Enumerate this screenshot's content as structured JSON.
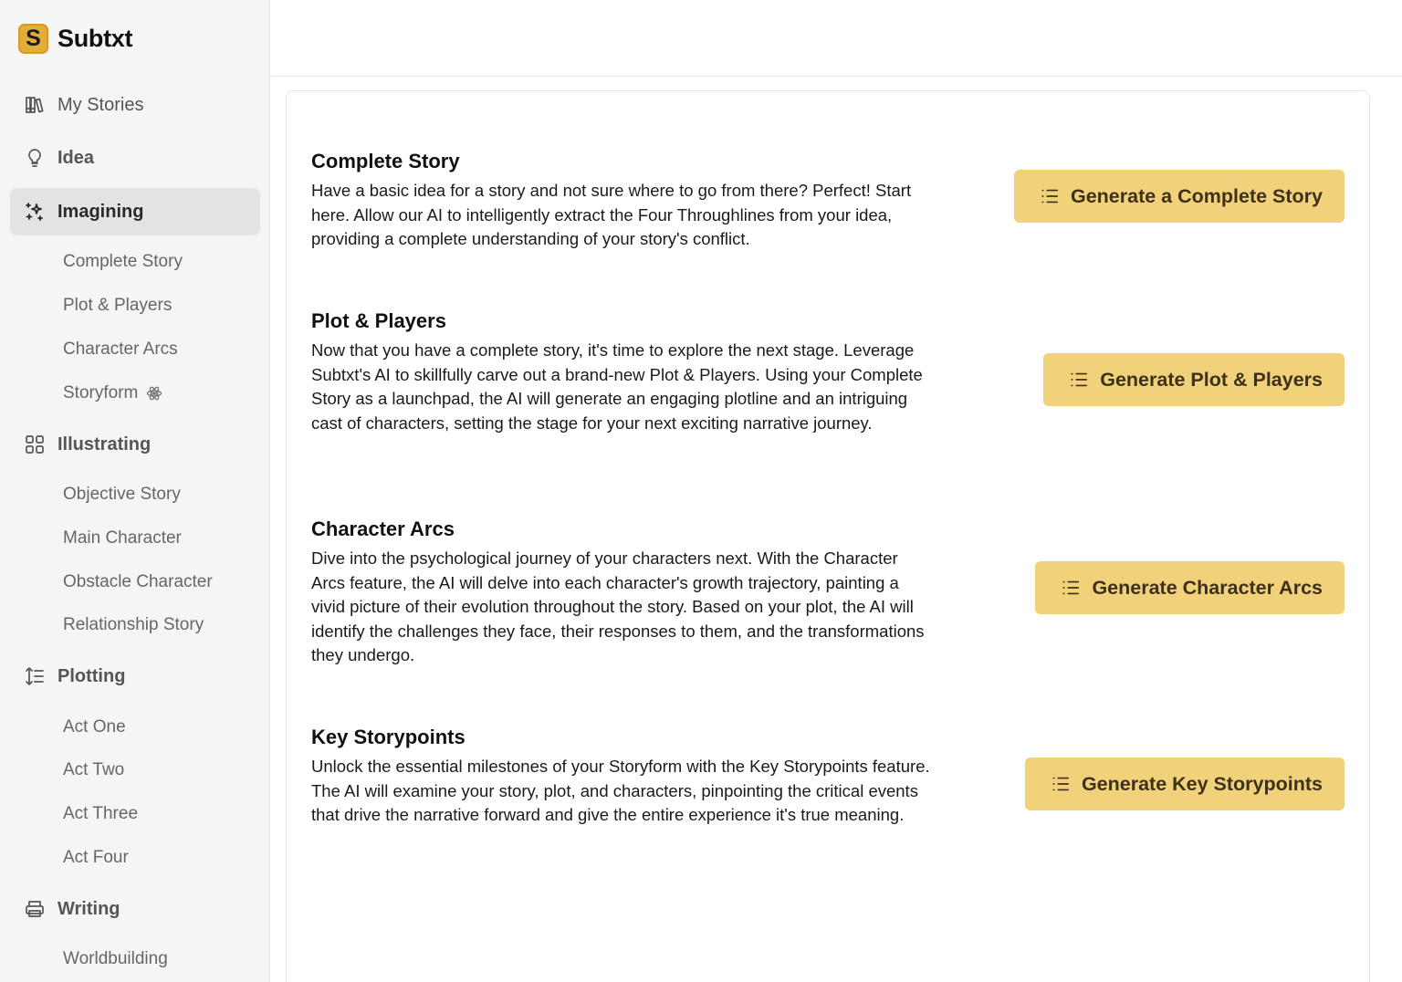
{
  "brand": {
    "logo_letter": "S",
    "name": "Subtxt",
    "accent": "#e3ad3c"
  },
  "sidebar": {
    "my_stories": {
      "label": "My Stories",
      "icon": "library-icon"
    },
    "idea": {
      "label": "Idea",
      "icon": "lightbulb-icon"
    },
    "imagining": {
      "label": "Imagining",
      "icon": "sparkles-icon",
      "items": [
        "Complete Story",
        "Plot & Players",
        "Character Arcs",
        "Storyform"
      ]
    },
    "illustrating": {
      "label": "Illustrating",
      "icon": "grid-icon",
      "items": [
        "Objective Story",
        "Main Character",
        "Obstacle Character",
        "Relationship Story"
      ]
    },
    "plotting": {
      "label": "Plotting",
      "icon": "sort-list-icon",
      "items": [
        "Act One",
        "Act Two",
        "Act Three",
        "Act Four"
      ]
    },
    "writing": {
      "label": "Writing",
      "icon": "printer-icon",
      "items": [
        "Worldbuilding"
      ]
    }
  },
  "features": [
    {
      "title": "Complete Story",
      "description": "Have a basic idea for a story and not sure where to go from there? Perfect! Start here. Allow our AI to intelligently extract the Four Throughlines from your idea, providing a complete understanding of your story's conflict.",
      "button": "Generate a Complete Story"
    },
    {
      "title": "Plot & Players",
      "description": "Now that you have a complete story, it's time to explore the next stage. Leverage Subtxt's AI to skillfully carve out a brand-new Plot & Players. Using your Complete Story as a launchpad, the AI will generate an engaging plotline and an intriguing cast of characters, setting the stage for your next exciting narrative journey.",
      "button": "Generate Plot & Players"
    },
    {
      "title": "Character Arcs",
      "description": "Dive into the psychological journey of your characters next. With the Character Arcs feature, the AI will delve into each character's growth trajectory, painting a vivid picture of their evolution throughout the story. Based on your plot, the AI will identify the challenges they face, their responses to them, and the transformations they undergo.",
      "button": "Generate Character Arcs"
    },
    {
      "title": "Key Storypoints",
      "description": "Unlock the essential milestones of your Storyform with the Key Storypoints feature. The AI will examine your story, plot, and characters, pinpointing the critical events that drive the narrative forward and give the entire experience it's true meaning.",
      "button": "Generate Key Storypoints"
    }
  ],
  "colors": {
    "button_bg": "#f1d17a",
    "sidebar_bg": "#f5f5f5",
    "active_bg": "#e3e3e3"
  }
}
